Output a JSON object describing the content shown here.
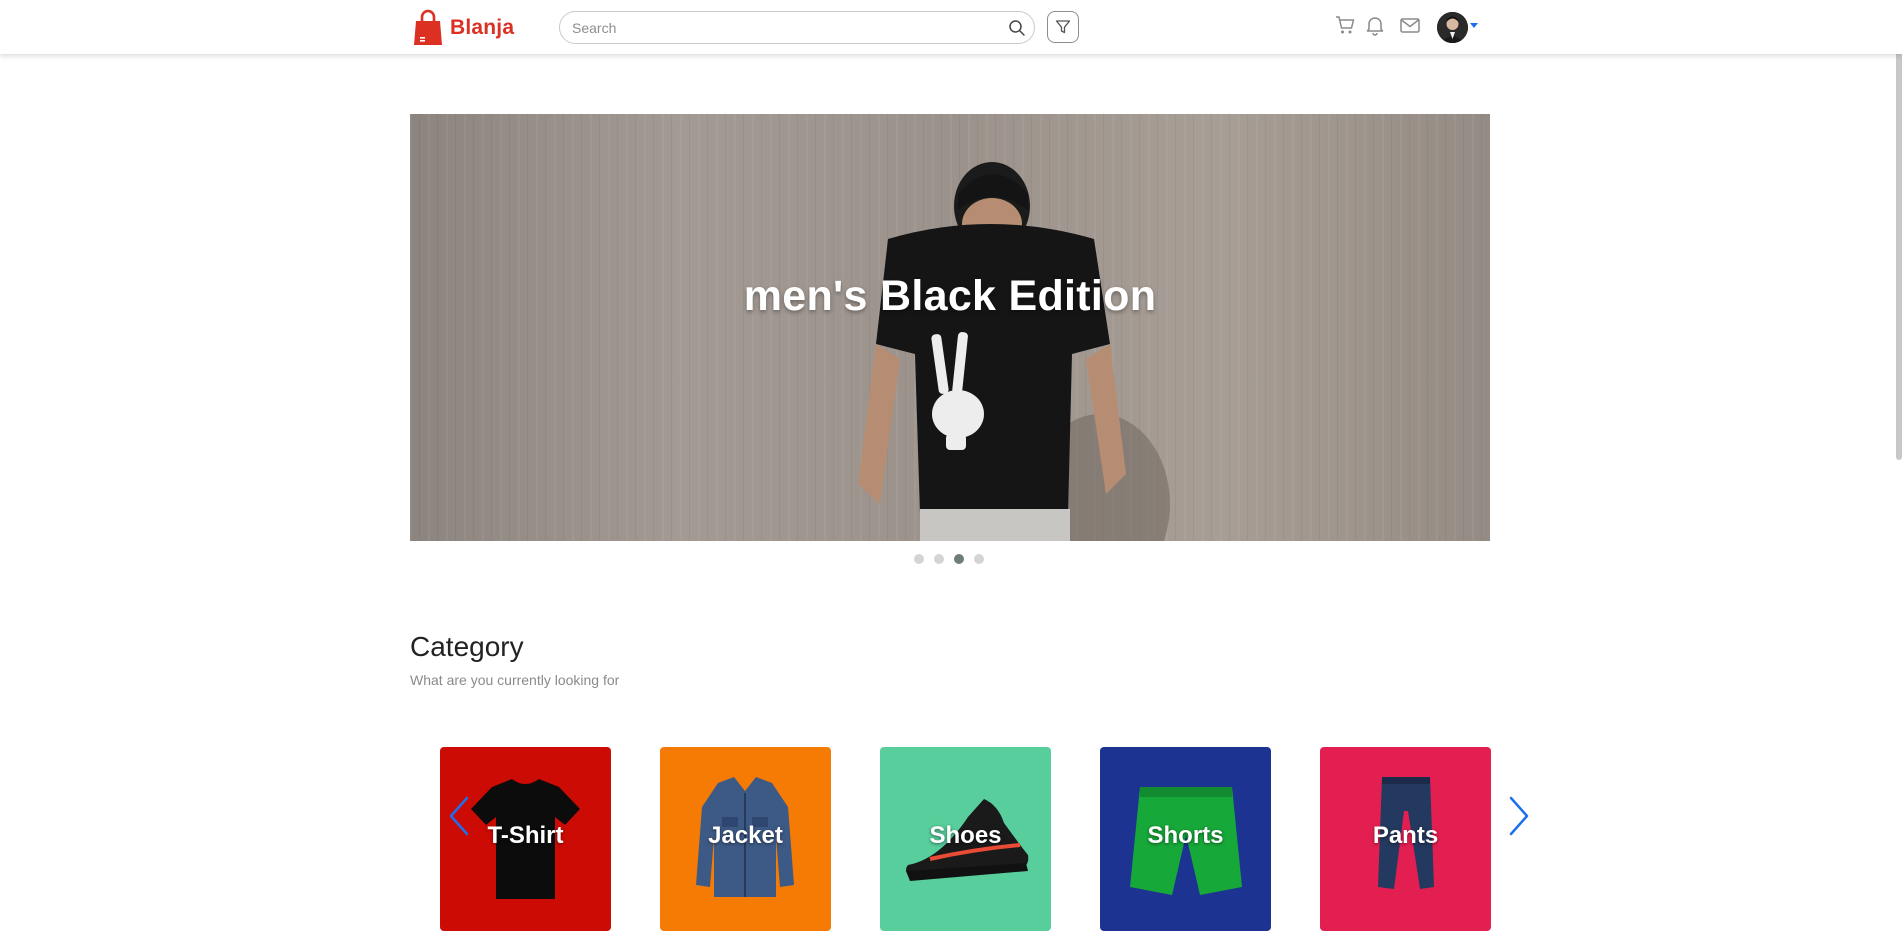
{
  "brand": {
    "name": "Blanja",
    "color": "#db3022"
  },
  "search": {
    "placeholder": "Search",
    "value": ""
  },
  "icons": [
    "search-icon",
    "filter-icon",
    "cart-icon",
    "bell-icon",
    "mail-icon",
    "chevron-down-icon",
    "chevron-left-icon",
    "chevron-right-icon"
  ],
  "hero": {
    "title": "men's Black Edition",
    "slide_count": 4,
    "active_slide": 3
  },
  "category": {
    "title": "Category",
    "subtitle": "What are you currently looking for",
    "items": [
      {
        "label": "T-Shirt",
        "color": "#cc0b04"
      },
      {
        "label": "Jacket",
        "color": "#f57b04"
      },
      {
        "label": "Shoes",
        "color": "#57ce9b"
      },
      {
        "label": "Shorts",
        "color": "#1c3391"
      },
      {
        "label": "Pants",
        "color": "#e31f51"
      }
    ]
  }
}
